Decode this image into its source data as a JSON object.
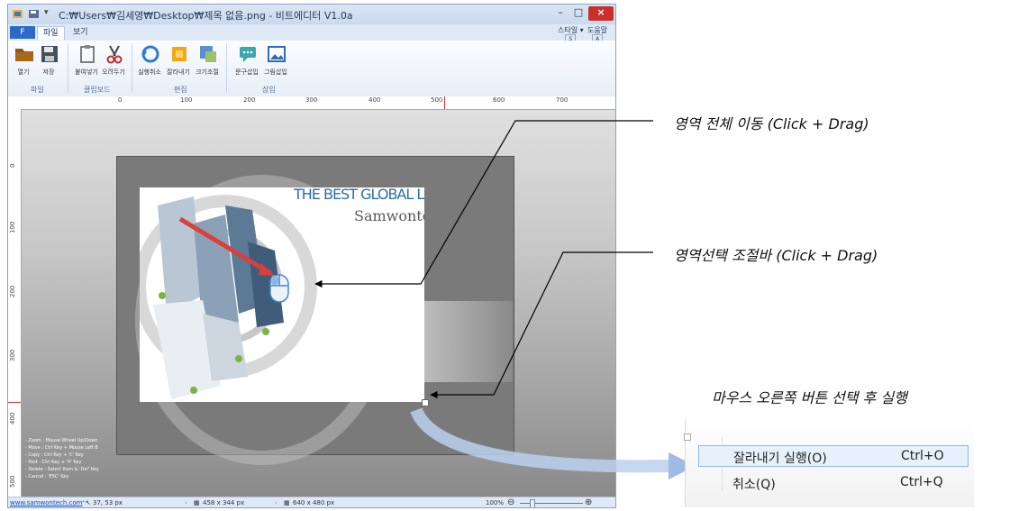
{
  "window": {
    "title": "C:₩Users₩김세영₩Desktop₩제목 없음.png - 비트에디터 V1.0a",
    "min_label": "–",
    "max_label": "□",
    "close_label": "×"
  },
  "ribbon": {
    "file_tab": "F",
    "tabs": [
      "파일",
      "보기"
    ],
    "right_items": [
      {
        "label": "스타일 ▾",
        "key": "S"
      },
      {
        "label": "도움말",
        "key": "A"
      }
    ],
    "buttons": [
      {
        "label": "열기",
        "icon": "folder-icon"
      },
      {
        "label": "저장",
        "icon": "save-icon"
      },
      {
        "label": "붙여넣기",
        "icon": "clipboard-icon"
      },
      {
        "label": "오려두기",
        "icon": "scissors-icon"
      },
      {
        "label": "실행취소",
        "icon": "undo-icon"
      },
      {
        "label": "잘라내기",
        "icon": "crop-icon"
      },
      {
        "label": "크기조절",
        "icon": "resize-icon"
      },
      {
        "label": "문구삽입",
        "icon": "speech-bubble-icon"
      },
      {
        "label": "그림삽입",
        "icon": "picture-icon"
      }
    ],
    "groups": [
      "파일",
      "클립보드",
      "편집",
      "삽입"
    ]
  },
  "ruler": {
    "top_labels": [
      "0",
      "100",
      "200",
      "300",
      "400",
      "500",
      "600",
      "700"
    ],
    "left_labels": [
      "0",
      "100",
      "200",
      "300",
      "400",
      "500"
    ]
  },
  "canvas": {
    "brand_line1": "THE BEST GLOBAL LEADER",
    "brand_line2": "Samwontech",
    "help_lines": [
      "- Zoom : Mouse Wheel Up/Down",
      "- Move : Ctrl Key + Mouse Left B",
      "- Copy : Ctrl Key + 'C' Key",
      "- Past : Ctrl Key + 'V' Key",
      "- Delete : Select Item & 'Del' Key",
      "- Cancel : 'ESC' Key"
    ]
  },
  "status": {
    "link": "www.samwontech.com",
    "cursor": "37, 53 px",
    "selection": "458 x 344 px",
    "image_size": "640 x 480 px",
    "zoom": "100%",
    "zoom_out": "⊖",
    "zoom_in": "⊕"
  },
  "annotations": {
    "move_all": "영역 전체 이동 (Click + Drag)",
    "resize_bar": "영역선택 조절바 (Click + Drag)",
    "right_click": "마우스 오른쪽 버튼 선택 후 실행"
  },
  "context_menu": {
    "items": [
      {
        "label": "잘라내기 실행(O)",
        "shortcut": "Ctrl+O"
      },
      {
        "label": "취소(Q)",
        "shortcut": "Ctrl+Q"
      }
    ]
  },
  "colors": {
    "accent": "#2b6ac7",
    "arrow": "#9fbbe6",
    "close": "#c9302c"
  }
}
